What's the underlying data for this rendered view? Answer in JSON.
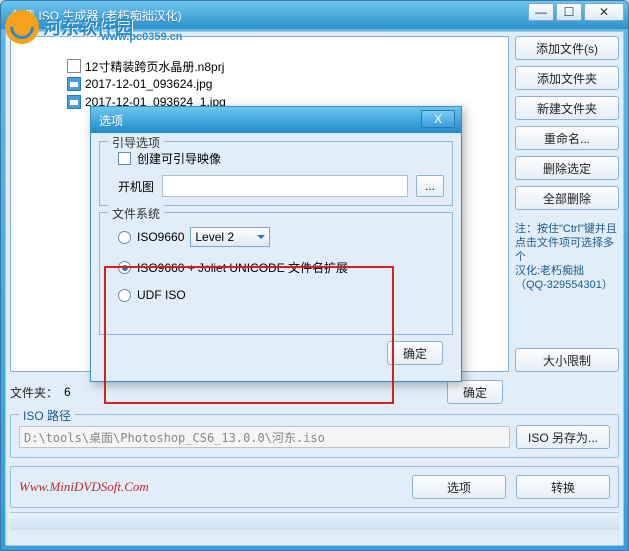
{
  "window": {
    "title": "免费 ISO 生成器 (老朽痴拙汉化)",
    "min": "—",
    "max": "☐",
    "close": "✕"
  },
  "watermark": {
    "brand": "河东软件园",
    "url": "www.pc0359.cn"
  },
  "files": {
    "items": [
      {
        "name": "12寸精装跨页水晶册.n8prj",
        "type": "prj"
      },
      {
        "name": "2017-12-01_093624.jpg",
        "type": "img"
      },
      {
        "name": "2017-12-01_093624_1.jpg",
        "type": "img"
      }
    ]
  },
  "sidebar": {
    "add_files": "添加文件(s)",
    "add_folder": "添加文件夹",
    "new_folder": "新建文件夹",
    "rename": "重命名...",
    "delete_sel": "删除选定",
    "delete_all": "全部删除",
    "hint": "注：按住\"Ctrl\"键并且点击文件项可选择多个\n汉化:老朽痴拙\n（QQ-329554301）",
    "size_limit": "大小限制"
  },
  "folder_row": {
    "label": "文件夹：",
    "count": "6",
    "ok": "确定"
  },
  "iso": {
    "legend": "ISO 路径",
    "path": "D:\\tools\\桌面\\Photoshop_CS6_13.0.0\\河东.iso",
    "save_as": "ISO 另存为..."
  },
  "bottom": {
    "website": "Www.MiniDVDSoft.Com",
    "options": "选项",
    "convert": "转换"
  },
  "dialog": {
    "title": "选项",
    "close": "X",
    "boot": {
      "legend": "引导选项",
      "create": "创建可引导映像",
      "boot_img": "开机图",
      "browse": "..."
    },
    "fs": {
      "legend": "文件系统",
      "iso9660": "ISO9660",
      "level": "Level 2",
      "joliet": "ISO9660 + Joliet UNICODE 文件名扩展",
      "udf": "UDF ISO"
    },
    "ok": "确定"
  }
}
